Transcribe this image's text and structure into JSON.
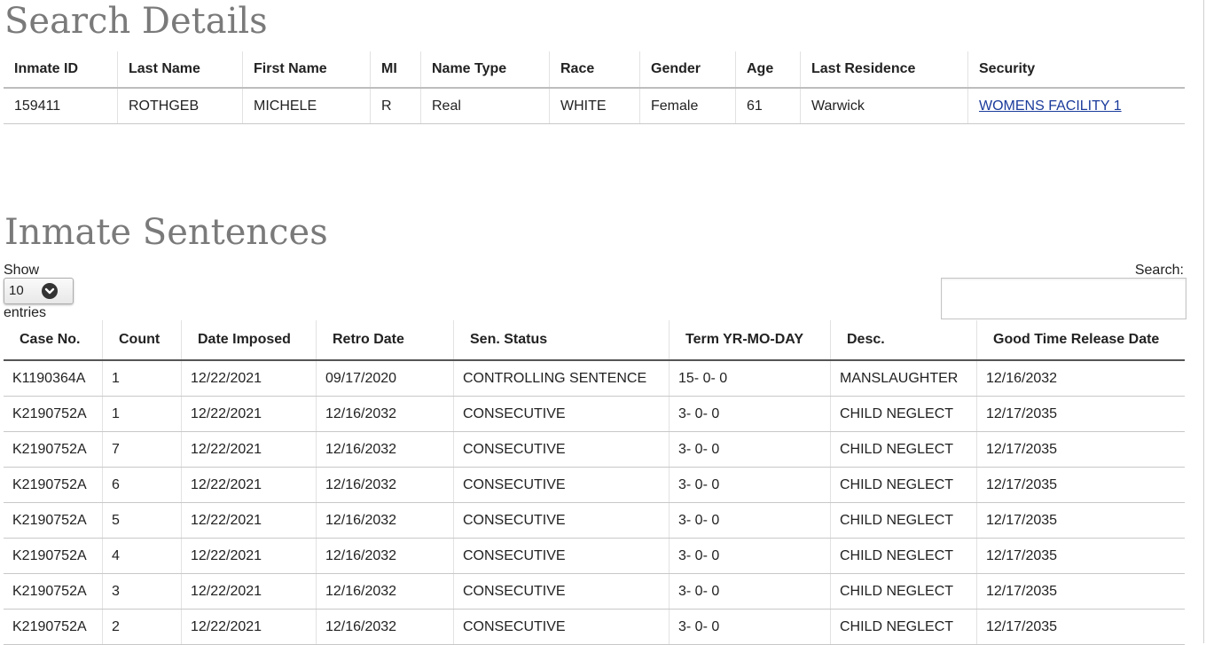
{
  "search_details": {
    "title": "Search Details",
    "columns": [
      "Inmate ID",
      "Last Name",
      "First Name",
      "MI",
      "Name Type",
      "Race",
      "Gender",
      "Age",
      "Last Residence",
      "Security"
    ],
    "row": [
      "159411",
      "ROTHGEB",
      "MICHELE",
      "R",
      "Real",
      "WHITE",
      "Female",
      "61",
      "Warwick",
      "WOMENS FACILITY 1"
    ]
  },
  "sentences": {
    "title": "Inmate Sentences",
    "show_label": "Show",
    "entries_label": "entries",
    "page_length": "10",
    "search_label": "Search:",
    "search_value": "",
    "columns": [
      "Case No.",
      "Count",
      "Date Imposed",
      "Retro Date",
      "Sen. Status",
      "Term YR-MO-DAY",
      "Desc.",
      "Good Time Release Date"
    ],
    "rows": [
      [
        "K1190364A",
        "1",
        "12/22/2021",
        "09/17/2020",
        "CONTROLLING SENTENCE",
        "15- 0- 0",
        "MANSLAUGHTER",
        "12/16/2032"
      ],
      [
        "K2190752A",
        "1",
        "12/22/2021",
        "12/16/2032",
        "CONSECUTIVE",
        "3- 0- 0",
        "CHILD NEGLECT",
        "12/17/2035"
      ],
      [
        "K2190752A",
        "7",
        "12/22/2021",
        "12/16/2032",
        "CONSECUTIVE",
        "3- 0- 0",
        "CHILD NEGLECT",
        "12/17/2035"
      ],
      [
        "K2190752A",
        "6",
        "12/22/2021",
        "12/16/2032",
        "CONSECUTIVE",
        "3- 0- 0",
        "CHILD NEGLECT",
        "12/17/2035"
      ],
      [
        "K2190752A",
        "5",
        "12/22/2021",
        "12/16/2032",
        "CONSECUTIVE",
        "3- 0- 0",
        "CHILD NEGLECT",
        "12/17/2035"
      ],
      [
        "K2190752A",
        "4",
        "12/22/2021",
        "12/16/2032",
        "CONSECUTIVE",
        "3- 0- 0",
        "CHILD NEGLECT",
        "12/17/2035"
      ],
      [
        "K2190752A",
        "3",
        "12/22/2021",
        "12/16/2032",
        "CONSECUTIVE",
        "3- 0- 0",
        "CHILD NEGLECT",
        "12/17/2035"
      ],
      [
        "K2190752A",
        "2",
        "12/22/2021",
        "12/16/2032",
        "CONSECUTIVE",
        "3- 0- 0",
        "CHILD NEGLECT",
        "12/17/2035"
      ]
    ]
  },
  "icons": {
    "page_length_dropdown": "chevron-down-icon"
  },
  "colors": {
    "heading": "#7a7a7a",
    "link": "#1a3b9b"
  }
}
